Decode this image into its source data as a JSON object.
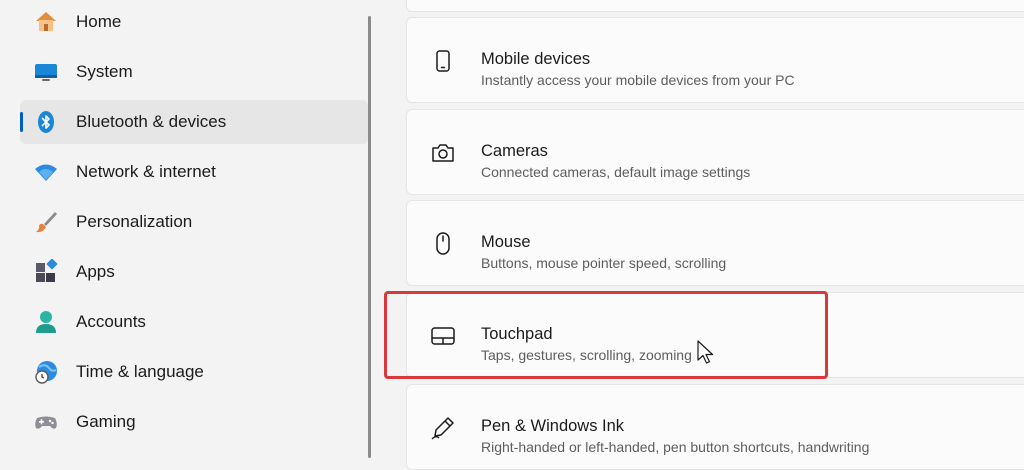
{
  "sidebar": {
    "items": [
      {
        "label": "Home",
        "icon": "home-icon"
      },
      {
        "label": "System",
        "icon": "system-icon"
      },
      {
        "label": "Bluetooth & devices",
        "icon": "bluetooth-icon",
        "selected": true
      },
      {
        "label": "Network & internet",
        "icon": "wifi-icon"
      },
      {
        "label": "Personalization",
        "icon": "brush-icon"
      },
      {
        "label": "Apps",
        "icon": "apps-icon"
      },
      {
        "label": "Accounts",
        "icon": "account-icon"
      },
      {
        "label": "Time & language",
        "icon": "globe-clock-icon"
      },
      {
        "label": "Gaming",
        "icon": "gamepad-icon"
      }
    ]
  },
  "main": {
    "cards": [
      {
        "title": "Mobile devices",
        "subtitle": "Instantly access your mobile devices from your PC",
        "icon": "phone-icon"
      },
      {
        "title": "Cameras",
        "subtitle": "Connected cameras, default image settings",
        "icon": "camera-icon"
      },
      {
        "title": "Mouse",
        "subtitle": "Buttons, mouse pointer speed, scrolling",
        "icon": "mouse-icon"
      },
      {
        "title": "Touchpad",
        "subtitle": "Taps, gestures, scrolling, zooming",
        "icon": "touchpad-icon",
        "highlighted": true
      },
      {
        "title": "Pen & Windows Ink",
        "subtitle": "Right-handed or left-handed, pen button shortcuts, handwriting",
        "icon": "pen-icon"
      }
    ]
  },
  "colors": {
    "accent": "#005fb8",
    "highlight_border": "#d9383d"
  }
}
